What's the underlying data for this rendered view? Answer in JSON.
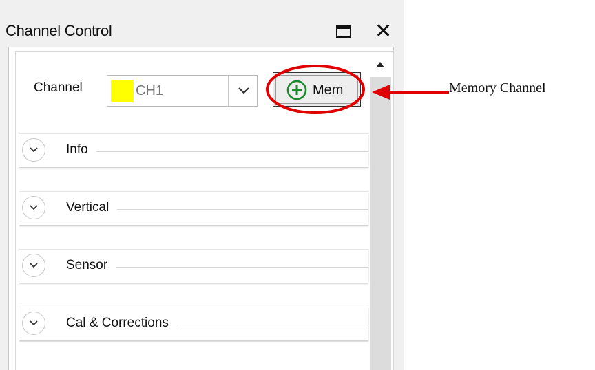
{
  "panel": {
    "title": "Channel Control"
  },
  "channel": {
    "label": "Channel",
    "value": "CH1",
    "swatch_color": "#ffff00"
  },
  "mem_button": {
    "label": "Mem",
    "icon": "plus-circle-icon",
    "icon_color": "#1a8a2a"
  },
  "annotation": {
    "text": "Memory Channel",
    "color": "#e00000"
  },
  "sections": [
    {
      "label": "Info"
    },
    {
      "label": "Vertical"
    },
    {
      "label": "Sensor"
    },
    {
      "label": "Cal & Corrections"
    }
  ]
}
